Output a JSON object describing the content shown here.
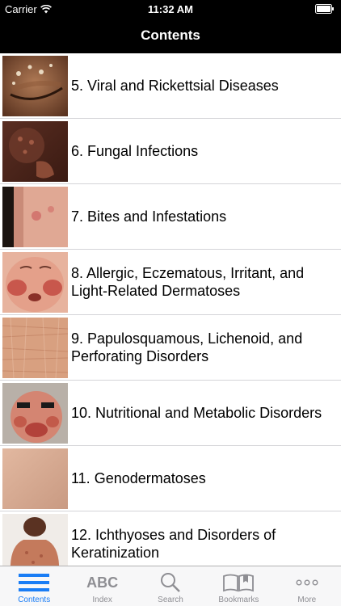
{
  "status_bar": {
    "carrier": "Carrier",
    "time": "11:32 AM"
  },
  "nav": {
    "title": "Contents"
  },
  "list": {
    "items": [
      {
        "label": "5. Viral and Rickettsial Diseases",
        "icon": "closed-eye-lesion-thumbnail"
      },
      {
        "label": "6. Fungal Infections",
        "icon": "scalp-rash-thumbnail"
      },
      {
        "label": "7. Bites and Infestations",
        "icon": "arm-bite-thumbnail"
      },
      {
        "label": "8. Allergic, Eczematous, Irritant, and Light-Related Dermatoses",
        "icon": "infant-face-rash-thumbnail"
      },
      {
        "label": "9. Papulosquamous, Lichenoid, and Perforating Disorders",
        "icon": "scaly-skin-thumbnail"
      },
      {
        "label": "10. Nutritional and Metabolic Disorders",
        "icon": "infant-face-dermatitis-thumbnail"
      },
      {
        "label": "11. Genodermatoses",
        "icon": "skin-surface-thumbnail"
      },
      {
        "label": "12. Ichthyoses and Disorders of Keratinization",
        "icon": "child-torso-thumbnail"
      }
    ]
  },
  "tabs": [
    {
      "label": "Contents",
      "icon": "list-icon",
      "active": true
    },
    {
      "label": "Index",
      "icon": "abc-icon",
      "glyph": "ABC",
      "active": false
    },
    {
      "label": "Search",
      "icon": "search-icon",
      "active": false
    },
    {
      "label": "Bookmarks",
      "icon": "book-icon",
      "active": false
    },
    {
      "label": "More",
      "icon": "more-icon",
      "active": false
    }
  ],
  "colors": {
    "bar_background": "#000000",
    "tab_active": "#1a7df5",
    "tab_inactive": "#8e8e93"
  }
}
